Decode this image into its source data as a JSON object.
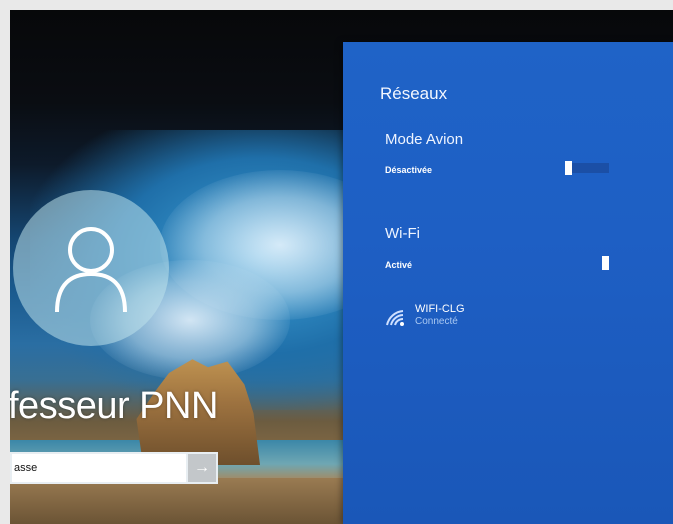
{
  "login": {
    "user_name": "fesseur PNN",
    "password_placeholder": "asse"
  },
  "network_panel": {
    "title": "Réseaux",
    "airplane": {
      "label": "Mode Avion",
      "state": "Désactivée",
      "on": false
    },
    "wifi": {
      "label": "Wi-Fi",
      "state": "Activé",
      "on": true
    },
    "connection": {
      "name": "WIFI-CLG",
      "status": "Connecté"
    }
  },
  "colors": {
    "flyout_blue": "#1e5fc4",
    "status_text": "#a9c8f2"
  },
  "icons": {
    "avatar": "user-icon",
    "submit": "arrow-right-icon",
    "wifi": "wifi-icon"
  }
}
